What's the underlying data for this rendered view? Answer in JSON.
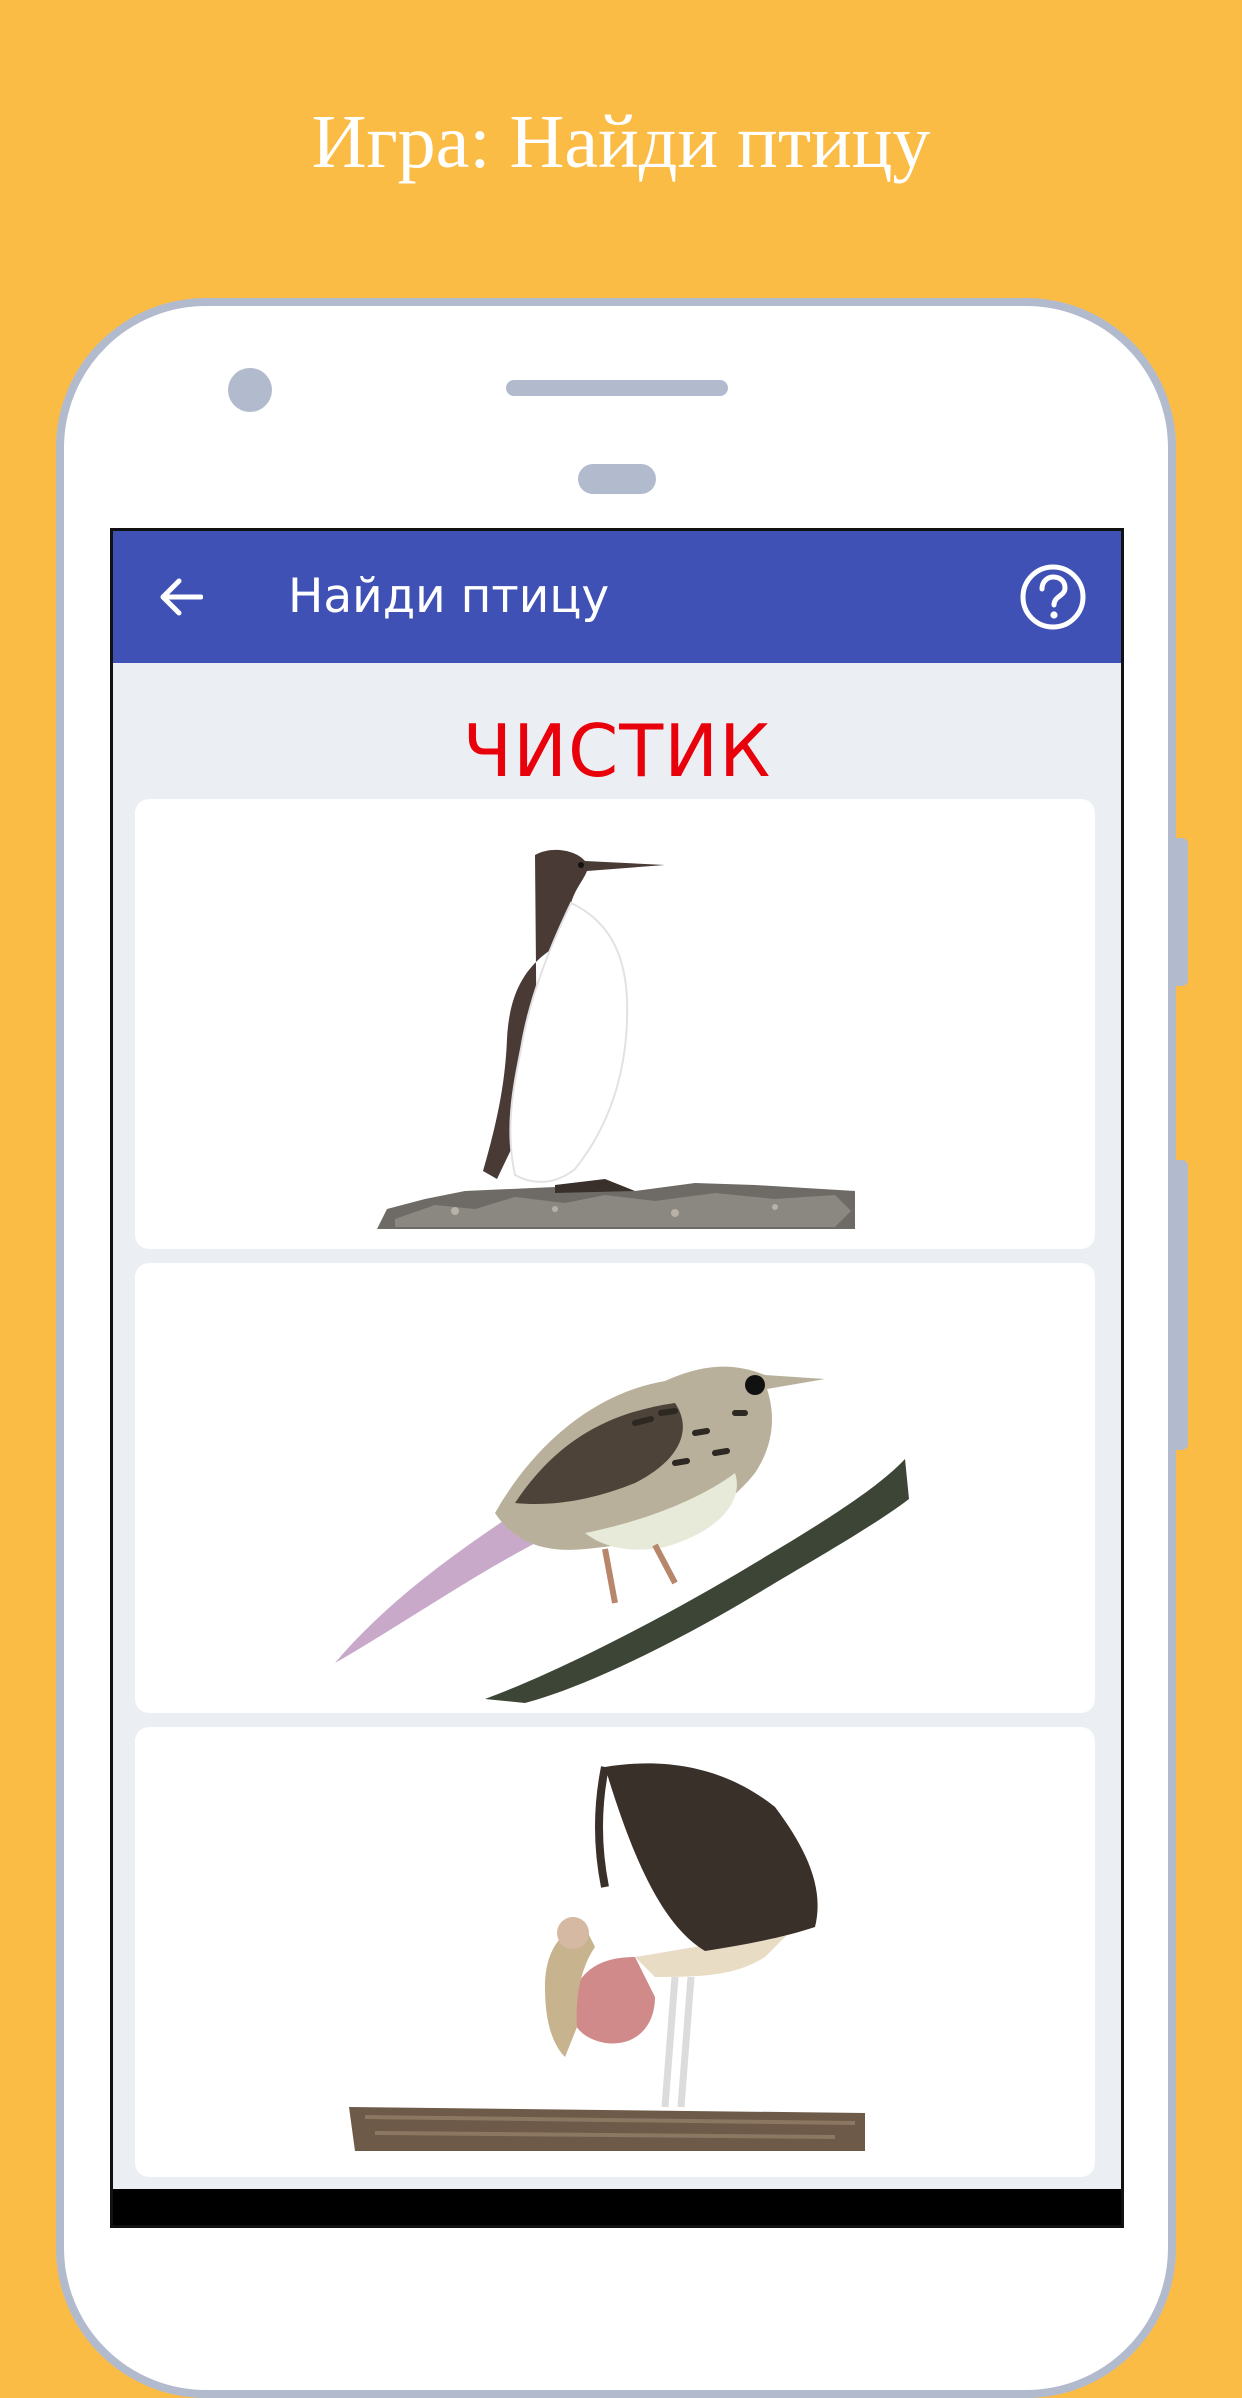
{
  "promo": {
    "title": "Игра: Найди птицу"
  },
  "appbar": {
    "back_icon": "arrow-left-icon",
    "title": "Найди птицу",
    "help_icon": "help-circle-icon"
  },
  "question": {
    "bird_name": "ЧИСТИК"
  },
  "answers": [
    {
      "image": "guillemot-on-rock"
    },
    {
      "image": "pipit-on-branch"
    },
    {
      "image": "marabou-stork-on-log"
    }
  ],
  "colors": {
    "background": "#FBBC46",
    "appbar": "#3F51B5",
    "question_text": "#E8000A",
    "screen_bg": "#EBEEF2",
    "device_frame": "#B2BBCD"
  }
}
